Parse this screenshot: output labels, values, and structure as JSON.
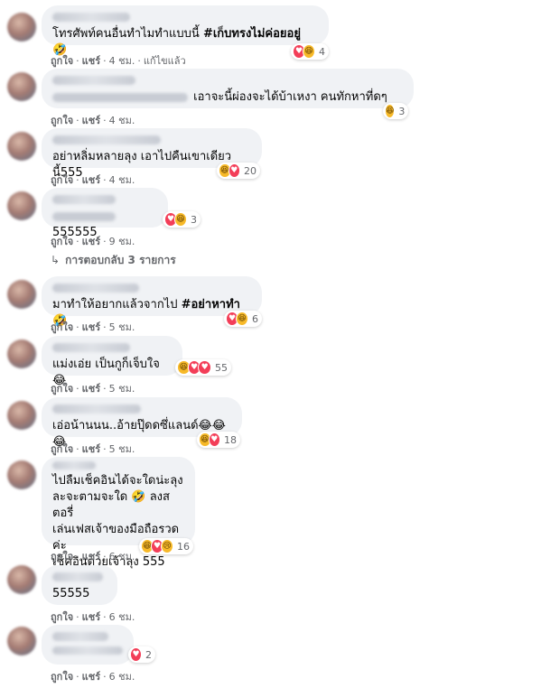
{
  "labels": {
    "like": "ถูกใจ",
    "reply": "แชร์",
    "sep": "·",
    "edited": "แก้ไขแล้ว"
  },
  "comments": [
    {
      "text_pre": "โทรศัพท์คนอื่นทำไมทำแบบนี้ ",
      "text_bold": "#เก็บทรงไม่ค่อยอยู่",
      "text_post": " 🤣",
      "reacts": [
        "love",
        "haha"
      ],
      "count": "4",
      "time": "4 ชม."
    },
    {
      "text_pre": "เอาจะนี้ผ่องจะได้บ้าเหงา คนทักหาที่ดๆ",
      "reacts": [
        "haha"
      ],
      "count": "3",
      "time": "4 ชม."
    },
    {
      "text_pre": "อย่าหลิ่มหลายลุง เอาไปคืนเขาเดียวนี้555",
      "reacts": [
        "haha",
        "love"
      ],
      "count": "20",
      "time": "4 ชม."
    },
    {
      "text_pre": "555555",
      "reacts": [
        "love",
        "haha"
      ],
      "count": "3",
      "time": "9 ชม."
    },
    {
      "text_pre": "มาทำให้อยากแล้วจากไป ",
      "text_bold": "#อย่าหาทำ",
      "text_post": " 🤣",
      "reacts": [
        "love",
        "haha"
      ],
      "count": "6",
      "time": "5 ชม."
    },
    {
      "text_pre": "แม่งเอ่ย เป็นกูก็เจ็บใจ 😂",
      "reacts": [
        "haha",
        "love",
        "love"
      ],
      "count": "55",
      "time": "5 ชม."
    },
    {
      "text_pre": "เอ่อน้านนน..อ้ายปุ๊ดดซึ่แลนด์😂😂😂",
      "reacts": [
        "haha",
        "love"
      ],
      "count": "18",
      "time": "5 ชม."
    },
    {
      "text_pre": "ไปลืมเช็คอินได้จะใดน่ะลุง\nละจะตามจะใด 🤣 ลงสตอรี่\nเล่นเฟสเจ้าของมือถือรวดค่ะ\nเช็คอินตวยเจ้าลุง 555",
      "reacts": [
        "haha",
        "love",
        "sad"
      ],
      "count": "16",
      "time": "6 ชม."
    },
    {
      "text_pre": "55555",
      "reacts": [],
      "count": "",
      "time": "6 ชม."
    },
    {
      "text_pre": "",
      "reacts": [
        "love"
      ],
      "count": "2",
      "time": "6 ชม."
    }
  ],
  "replies_link": "การตอบกลับ 3 รายการ",
  "reply_arrow": "↳",
  "emoji": {
    "like": "👍",
    "love": "♥",
    "haha": "😆",
    "sad": "😢"
  }
}
